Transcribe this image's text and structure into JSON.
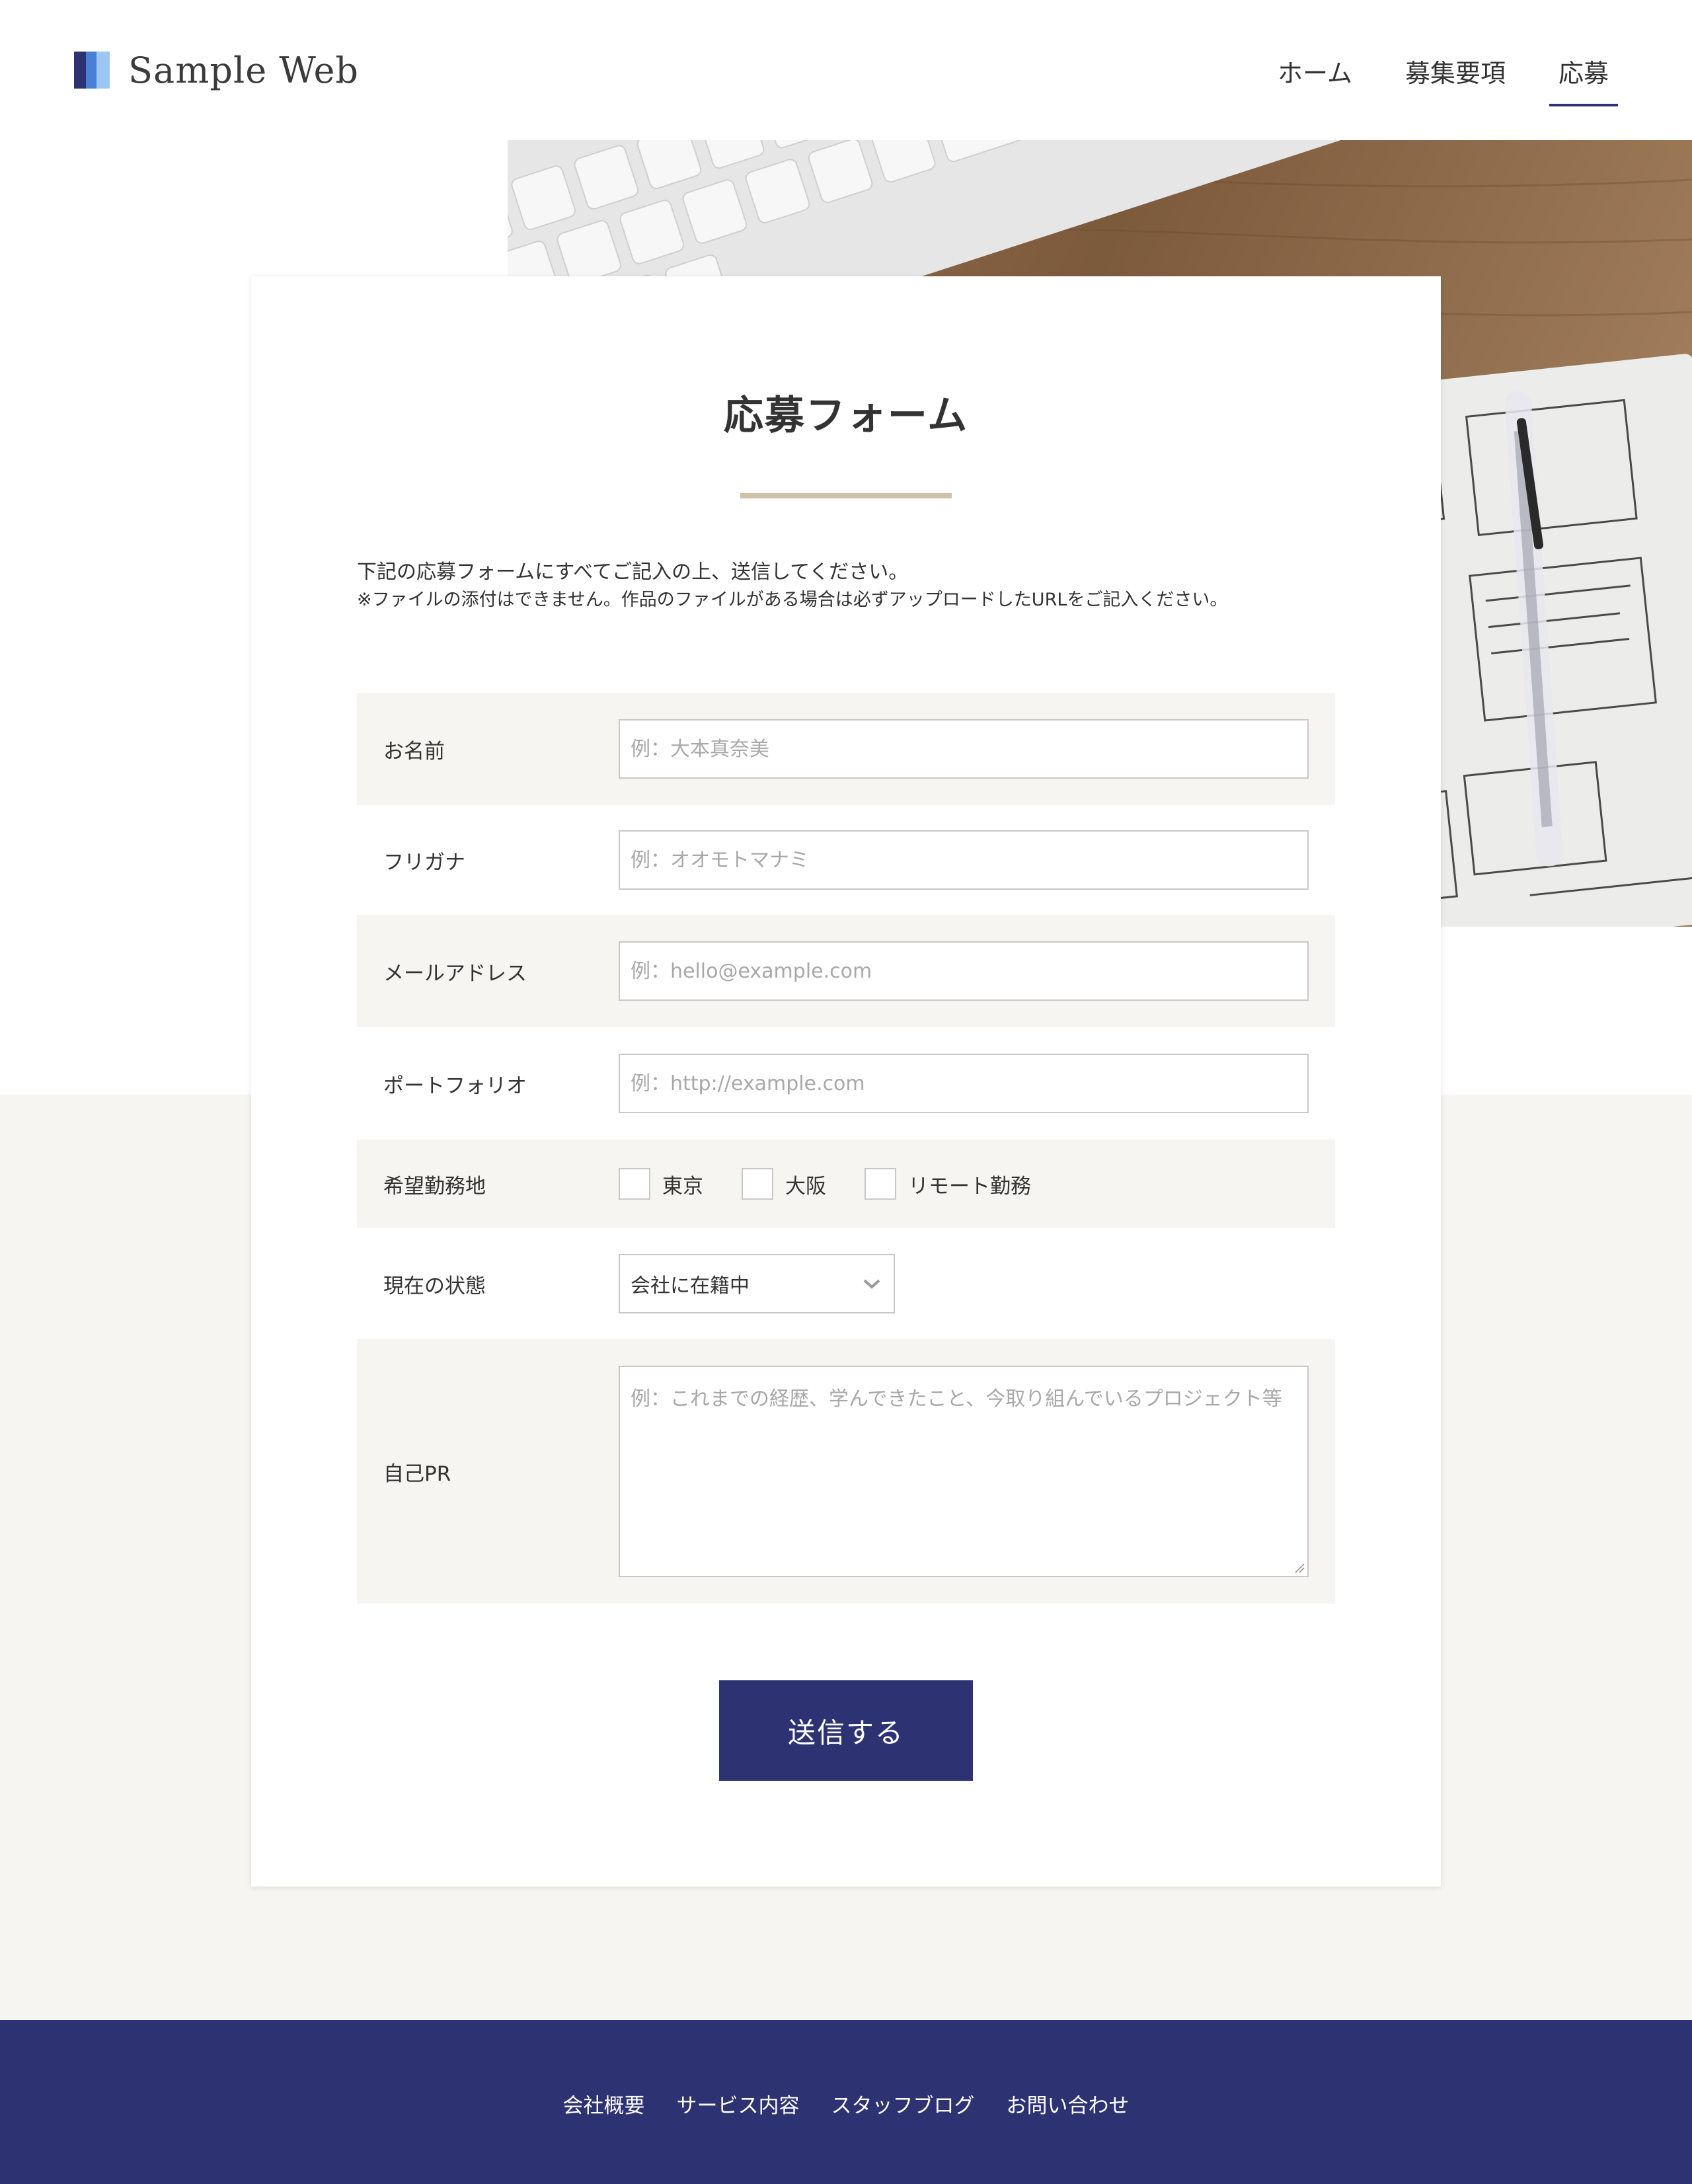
{
  "header": {
    "site_name": "Sample Web",
    "nav": [
      {
        "label": "ホーム"
      },
      {
        "label": "募集要項"
      },
      {
        "label": "応募"
      }
    ],
    "active_nav": "応募"
  },
  "form_card": {
    "title": "応募フォーム",
    "intro_line1": "下記の応募フォームにすべてご記入の上、送信してください。",
    "intro_line2": "※ファイルの添付はできません。作品のファイルがある場合は必ずアップロードしたURLをご記入ください。",
    "fields": {
      "name": {
        "label": "お名前",
        "placeholder": "例：大本真奈美"
      },
      "furigana": {
        "label": "フリガナ",
        "placeholder": "例：オオモトマナミ"
      },
      "email": {
        "label": "メールアドレス",
        "placeholder": "例：hello@example.com"
      },
      "portfolio": {
        "label": "ポートフォリオ",
        "placeholder": "例：http://example.com"
      },
      "location": {
        "label": "希望勤務地",
        "options": [
          {
            "label": "東京",
            "checked": false
          },
          {
            "label": "大阪",
            "checked": false
          },
          {
            "label": "リモート勤務",
            "checked": false
          }
        ]
      },
      "status": {
        "label": "現在の状態",
        "selected": "会社に在籍中"
      },
      "pr": {
        "label": "自己PR",
        "placeholder": "例：これまでの経歴、学んできたこと、今取り組んでいるプロジェクト等"
      }
    },
    "submit_label": "送信する"
  },
  "footer": {
    "links": [
      {
        "label": "会社概要"
      },
      {
        "label": "サービス内容"
      },
      {
        "label": "スタッフブログ"
      },
      {
        "label": "お問い合わせ"
      }
    ]
  },
  "colors": {
    "brand_navy": "#2d3272",
    "accent_beige": "#cfc2a8",
    "shade": "#f6f5f1"
  },
  "icons": {
    "logo": "logo-bars-icon",
    "select_arrow": "chevron-down-icon"
  }
}
